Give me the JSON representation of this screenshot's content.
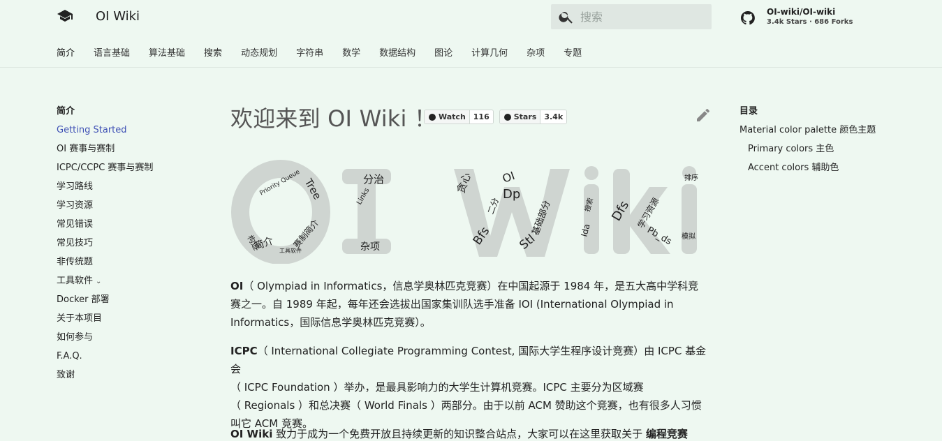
{
  "header": {
    "site_title": "OI Wiki",
    "search_placeholder": "搜索",
    "repo_name": "OI-wiki/OI-wiki",
    "repo_stats": "3.4k Stars · 686 Forks",
    "tabs": [
      "简介",
      "语言基础",
      "算法基础",
      "搜索",
      "动态规划",
      "字符串",
      "数学",
      "数据结构",
      "图论",
      "计算几何",
      "杂项",
      "专题"
    ]
  },
  "nav": {
    "title": "简介",
    "items": [
      "Getting Started",
      "OI 赛事与赛制",
      "ICPC/CCPC 赛事与赛制",
      "学习路线",
      "学习资源",
      "常见错误",
      "常见技巧",
      "非传统题",
      "工具软件",
      "Docker 部署",
      "关于本项目",
      "如何参与",
      "F.A.Q.",
      "致谢"
    ]
  },
  "toc": {
    "title": "目录",
    "items": [
      "Material color palette 颜色主题",
      "Primary colors 主色",
      "Accent colors 辅助色"
    ]
  },
  "main": {
    "title": "欢迎来到 OI Wiki ！",
    "badges": [
      {
        "label": "Watch",
        "count": "116"
      },
      {
        "label": "Stars",
        "count": "3.4k"
      }
    ],
    "cloud_words": [
      "Tree",
      "分治",
      "Priority Queue",
      "Links",
      "简介",
      "赛制简介",
      "杂项",
      "贪心",
      "OI",
      "Dp",
      "Bfs",
      "Stl",
      "基础部分",
      "Dfs",
      "学习资源",
      "Pb_ds",
      "Ida",
      "搜索",
      "排序",
      "模拟",
      "构造",
      "工具软件",
      "二分"
    ],
    "p1": {
      "lead": "OI",
      "line1": "（ Olympiad in Informatics，信息学奥林匹克竞赛）在中国起源于 1984 年，是五大高中学科竞",
      "line2": "赛之一。自 1989 年起，每年还会选拔出国家集训队选手准备 IOI (International Olympiad in",
      "line3": "Informatics，国际信息学奥林匹克竞赛）。"
    },
    "p2": {
      "lead": "ICPC",
      "line1": "（ International Collegiate Programming Contest, 国际大学生程序设计竞赛）由 ICPC 基金会",
      "line2": "（ ICPC Foundation ）举办，是最具影响力的大学生计算机竞赛。ICPC 主要分为区域赛",
      "line3": "（ Regionals ）和总决赛（ World Finals ）两部分。由于以前 ACM 赞助这个竞赛，也有很多人习惯",
      "line4": "叫它 ACM 竞赛。"
    },
    "p3": {
      "lead": "OI Wiki",
      "text": " 致力于成为一个免费开放且持续更新的知识整合站点，大家可以在这里获取关于 ",
      "bold_end": "编程竞赛"
    }
  }
}
